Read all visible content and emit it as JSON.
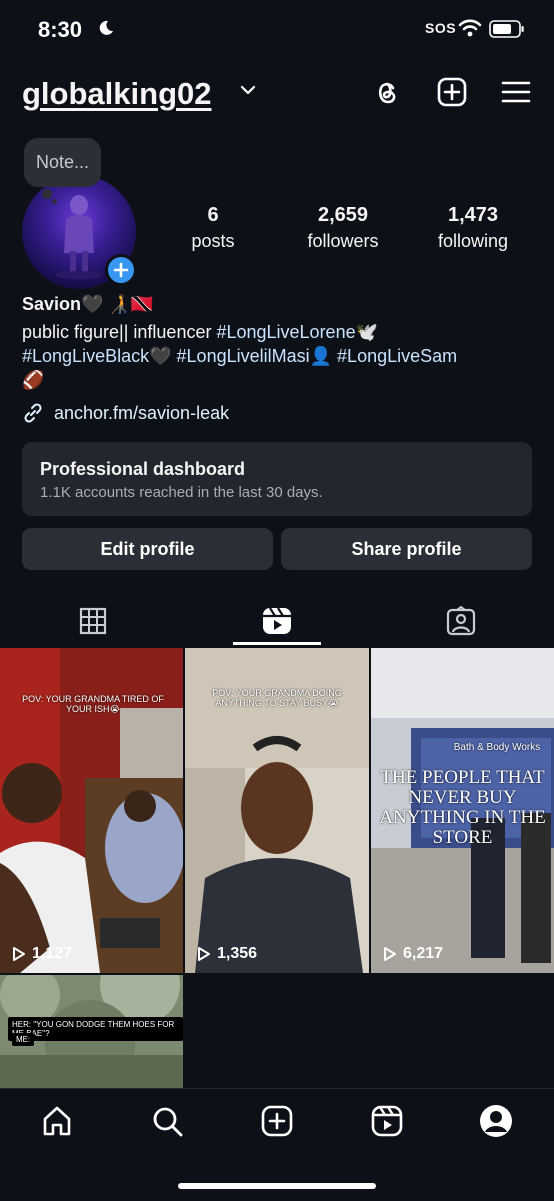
{
  "status_bar": {
    "time": "8:30",
    "sos": "SOS"
  },
  "header": {
    "username": "globalking02"
  },
  "note": {
    "placeholder": "Note..."
  },
  "stats": [
    {
      "value": "6",
      "label": "posts"
    },
    {
      "value": "2,659",
      "label": "followers"
    },
    {
      "value": "1,473",
      "label": "following"
    }
  ],
  "bio": {
    "name": "Savion🖤 🧑‍🦯🇹🇹",
    "line1_text": "public figure|| influencer ",
    "line1_tag": "#LongLiveLorene🕊️",
    "line2_tag1": "#LongLiveBlack🖤",
    "line2_tag2": "#LongLivelilMasi👤",
    "line2_tag3": "#LongLiveSam",
    "line3": "🏈",
    "link": "anchor.fm/savion-leak"
  },
  "dashboard": {
    "title": "Professional dashboard",
    "subtitle": "1.1K accounts reached in the last 30 days."
  },
  "buttons": {
    "edit": "Edit profile",
    "share": "Share profile"
  },
  "reels": [
    {
      "caption": "POV: YOUR GRANDMA TIRED OF YOUR ISH😭",
      "views": "1,127"
    },
    {
      "caption": "POV: YOUR GRANDMA DOING ANYTHING TO STAY BUSY😭",
      "views": "1,356"
    },
    {
      "caption": "THE PEOPLE THAT NEVER BUY ANYTHING IN THE STORE",
      "store_sign": "Bath & Body Works",
      "views": "6,217"
    },
    {
      "caption": "HER: \"YOU GON DODGE THEM HOES FOR ME BAE\"?",
      "caption2": "ME:"
    }
  ],
  "colors": {
    "accent": "#3797f0",
    "background": "#0d1117",
    "surface": "#22262d"
  }
}
